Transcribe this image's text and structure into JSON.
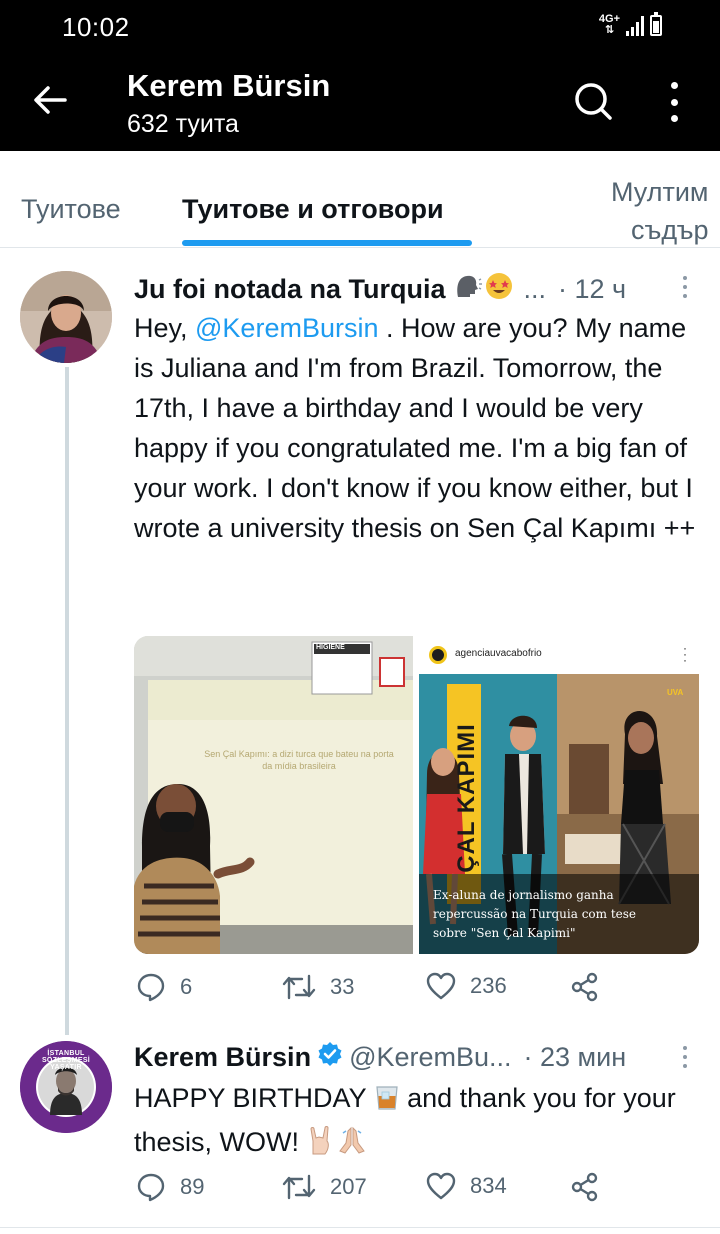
{
  "status_bar": {
    "time": "10:02",
    "network": "4G+"
  },
  "header": {
    "name": "Kerem Bürsin",
    "tweet_count": "632 туита"
  },
  "tabs": [
    {
      "label": "Туитове"
    },
    {
      "label": "Туитове и отговори",
      "active": true
    },
    {
      "label_line1": "Мултим",
      "label_line2": "съдър"
    }
  ],
  "tweets": [
    {
      "author": "Ju foi notada na Turquia",
      "meta_sep": "...",
      "time": "· 12 ч",
      "text_prefix": "Hey, ",
      "mention": "@KeremBursin",
      "text_suffix": " . How are you? My name is Juliana and I'm from Brazil. Tomorrow, the 17th, I have a birthday and I would be very happy if you congratulated me. I'm a big fan of your work. I don't know if you know either, but I wrote a university thesis on Sen Çal Kapımı ++",
      "media": {
        "slide_title": "Sen Çal Kapımı: a dizi turca que bateu na porta da mídia brasileira",
        "slide_label": "HIGIENE",
        "post_account": "agenciauvacabofrio",
        "post_badge": "UVA",
        "post_show": "ÇAL KAPIMI",
        "post_caption_1": "Ex-aluna de jornalismo ganha",
        "post_caption_2": "repercussão na Turquia com tese",
        "post_caption_3": "sobre \"Sen Çal Kapimi\""
      },
      "replies": "6",
      "retweets": "33",
      "likes": "236"
    },
    {
      "author": "Kerem Bürsin",
      "handle": "@KeremBu...",
      "time": "· 23 мин",
      "text_1": "HAPPY BIRTHDAY ",
      "text_2": " and thank you for your thesis, WOW! ",
      "avatar_ring_text": "İSTANBUL SÖZLEŞMESİ YAŞATIR",
      "replies": "89",
      "retweets": "207",
      "likes": "834"
    }
  ],
  "colors": {
    "accent": "#1d9bf0",
    "muted": "#536471",
    "header_bg": "#000000",
    "verified": "#1d9bf0"
  }
}
